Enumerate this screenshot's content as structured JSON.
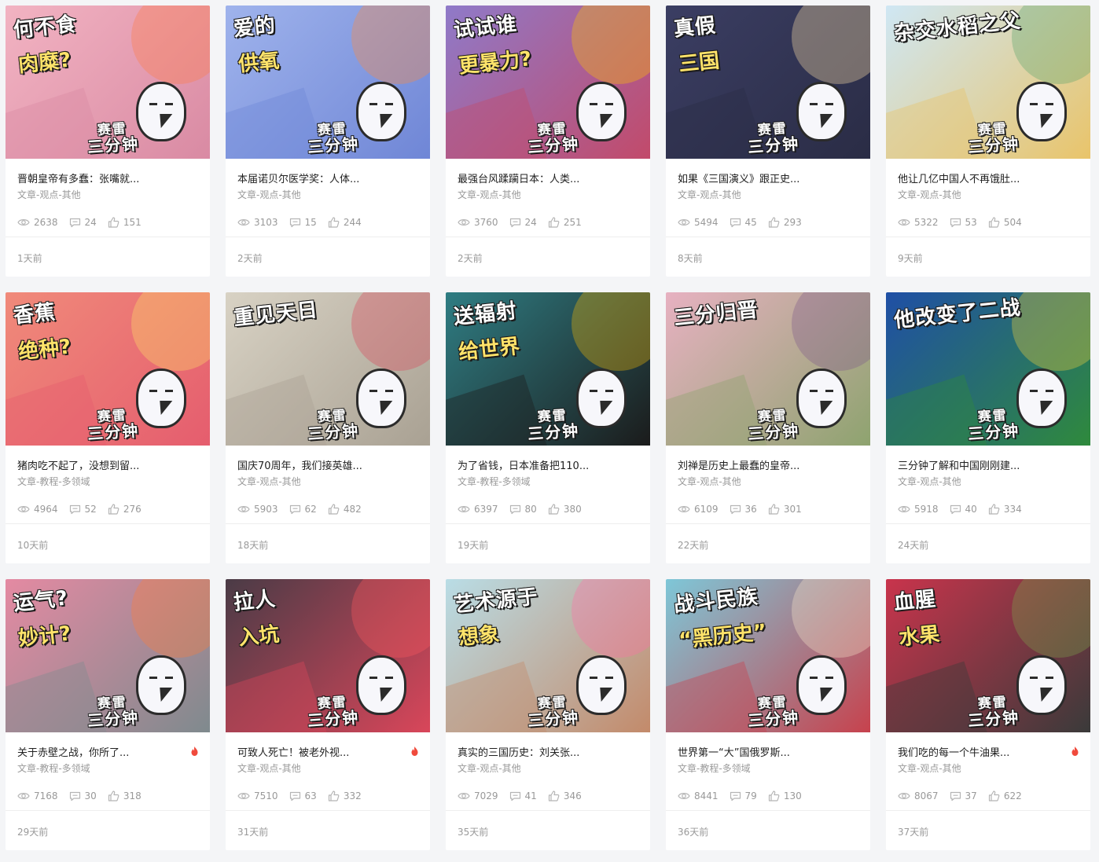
{
  "brand": {
    "line1": "赛雷",
    "line2": "三分钟"
  },
  "cards": [
    {
      "title": "晋朝皇帝有多蠢：张嘴就...",
      "category": "文章-观点-其他",
      "views": "2638",
      "comments": "24",
      "likes": "151",
      "time": "1天前",
      "hot": false,
      "thumb_text": "何不食",
      "thumb_text2": "肉糜?",
      "bg": "#f2b3c2",
      "bg2": "#d98aa3",
      "accent": "#ff7a45"
    },
    {
      "title": "本届诺贝尔医学奖：人体...",
      "category": "文章-观点-其他",
      "views": "3103",
      "comments": "15",
      "likes": "244",
      "time": "2天前",
      "hot": false,
      "thumb_text": "爱的",
      "thumb_text2": "供氧",
      "bg": "#9fb3ec",
      "bg2": "#6f86d6",
      "accent": "#ff8a3d"
    },
    {
      "title": "最强台风蹂躏日本：人类...",
      "category": "文章-观点-其他",
      "views": "3760",
      "comments": "24",
      "likes": "251",
      "time": "2天前",
      "hot": false,
      "thumb_text": "试试谁",
      "thumb_text2": "更暴力?",
      "bg": "#8f7ac9",
      "bg2": "#c24a6a",
      "accent": "#ffc400"
    },
    {
      "title": "如果《三国演义》跟正史...",
      "category": "文章-观点-其他",
      "views": "5494",
      "comments": "45",
      "likes": "293",
      "time": "8天前",
      "hot": false,
      "thumb_text": "真假",
      "thumb_text2": "三国",
      "bg": "#3b3e63",
      "bg2": "#2a2c45",
      "accent": "#ffe2a8"
    },
    {
      "title": "他让几亿中国人不再饿肚...",
      "category": "文章-观点-其他",
      "views": "5322",
      "comments": "53",
      "likes": "504",
      "time": "9天前",
      "hot": false,
      "thumb_text": "杂交水稻之父",
      "thumb_text2": "",
      "bg": "#cfe7f4",
      "bg2": "#e9c46a",
      "accent": "#5aa469"
    },
    {
      "title": "猪肉吃不起了，没想到留...",
      "category": "文章-教程-多领域",
      "views": "4964",
      "comments": "52",
      "likes": "276",
      "time": "10天前",
      "hot": false,
      "thumb_text": "香蕉",
      "thumb_text2": "绝种?",
      "bg": "#f08a7a",
      "bg2": "#e55d6e",
      "accent": "#ffe066"
    },
    {
      "title": "国庆70周年，我们接英雄...",
      "category": "文章-观点-其他",
      "views": "5903",
      "comments": "62",
      "likes": "482",
      "time": "18天前",
      "hot": false,
      "thumb_text": "重见天日",
      "thumb_text2": "",
      "bg": "#d8d2c4",
      "bg2": "#a9a193",
      "accent": "#d9465a"
    },
    {
      "title": "为了省钱，日本准备把110...",
      "category": "文章-教程-多领域",
      "views": "6397",
      "comments": "80",
      "likes": "380",
      "time": "19天前",
      "hot": false,
      "thumb_text": "送辐射",
      "thumb_text2": "给世界",
      "bg": "#2f7d83",
      "bg2": "#1b1b1b",
      "accent": "#f2b705"
    },
    {
      "title": "刘禅是历史上最蠢的皇帝...",
      "category": "文章-观点-其他",
      "views": "6109",
      "comments": "36",
      "likes": "301",
      "time": "22天前",
      "hot": false,
      "thumb_text": "三分归晋",
      "thumb_text2": "",
      "bg": "#e7b1c1",
      "bg2": "#8ea36f",
      "accent": "#7d5a8a"
    },
    {
      "title": "三分钟了解和中国刚刚建...",
      "category": "文章-观点-其他",
      "views": "5918",
      "comments": "40",
      "likes": "334",
      "time": "24天前",
      "hot": false,
      "thumb_text": "他改变了二战",
      "thumb_text2": "",
      "bg": "#1f4fa6",
      "bg2": "#2f8a3c",
      "accent": "#f2d03b"
    },
    {
      "title": "关于赤壁之战，你所了...",
      "category": "文章-教程-多领域",
      "views": "7168",
      "comments": "30",
      "likes": "318",
      "time": "29天前",
      "hot": true,
      "thumb_text": "运气?",
      "thumb_text2": "妙计?",
      "bg": "#e48aa2",
      "bg2": "#7f8a8e",
      "accent": "#ff7b3a"
    },
    {
      "title": "可致人死亡！被老外视...",
      "category": "文章-观点-其他",
      "views": "7510",
      "comments": "63",
      "likes": "332",
      "time": "31天前",
      "hot": true,
      "thumb_text": "拉人",
      "thumb_text2": "入坑",
      "bg": "#4a3b46",
      "bg2": "#d9465a",
      "accent": "#ff5a5f"
    },
    {
      "title": "真实的三国历史：刘关张...",
      "category": "文章-观点-其他",
      "views": "7029",
      "comments": "41",
      "likes": "346",
      "time": "35天前",
      "hot": false,
      "thumb_text": "艺术源于",
      "thumb_text2": "想象",
      "bg": "#b9dde6",
      "bg2": "#c38a6a",
      "accent": "#ff6fa5"
    },
    {
      "title": "世界第一“大”国俄罗斯...",
      "category": "文章-教程-多领域",
      "views": "8441",
      "comments": "79",
      "likes": "130",
      "time": "36天前",
      "hot": false,
      "thumb_text": "战斗民族",
      "thumb_text2": "“黑历史”",
      "bg": "#7ec7d8",
      "bg2": "#c7424d",
      "accent": "#f5e6c8"
    },
    {
      "title": "我们吃的每一个牛油果...",
      "category": "文章-观点-其他",
      "views": "8067",
      "comments": "37",
      "likes": "622",
      "time": "37天前",
      "hot": true,
      "thumb_text": "血腥",
      "thumb_text2": "水果",
      "bg": "#c9344c",
      "bg2": "#3a3a3a",
      "accent": "#7fa24a"
    }
  ]
}
